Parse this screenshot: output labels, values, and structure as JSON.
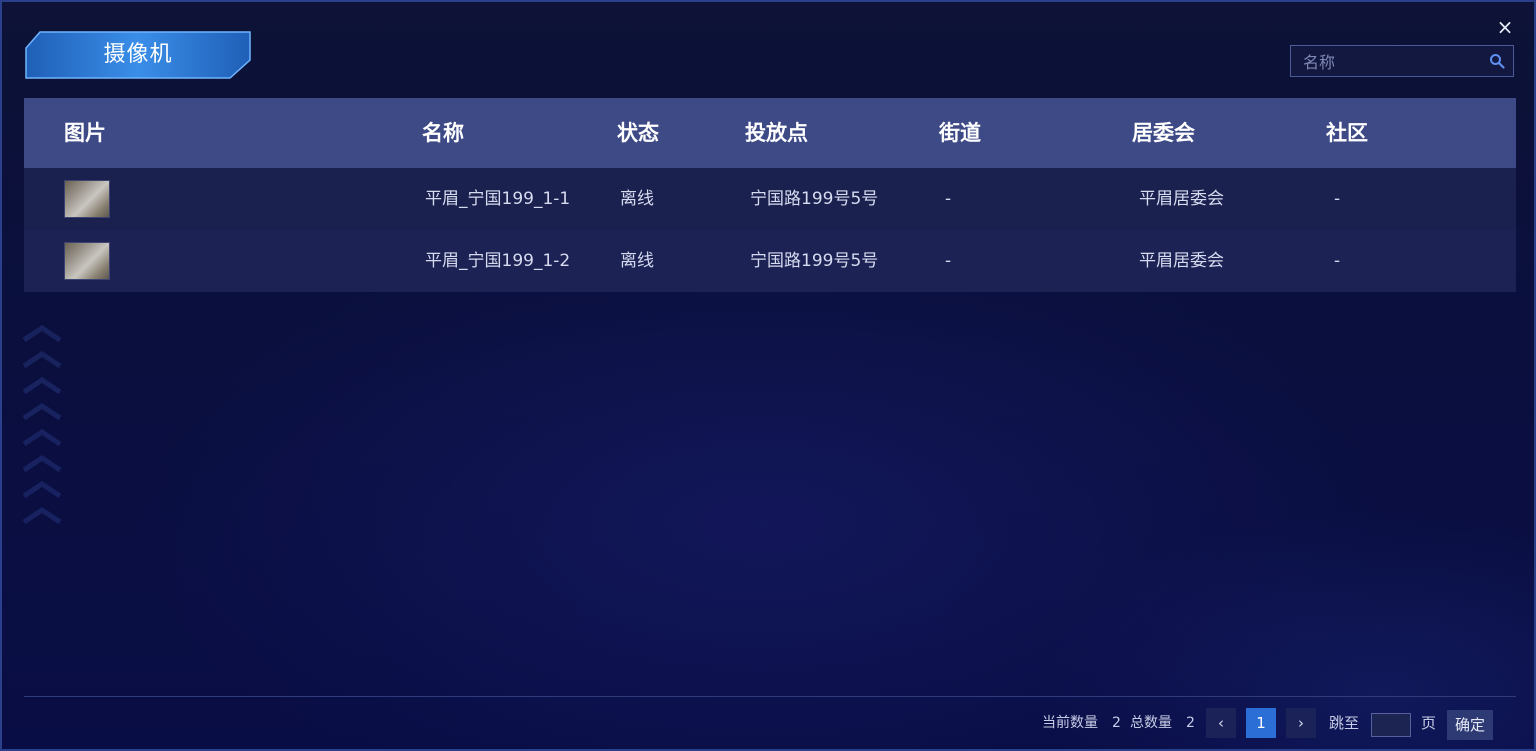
{
  "dialog": {
    "title": "摄像机",
    "close_label": "×"
  },
  "search": {
    "placeholder": "名称",
    "value": ""
  },
  "table": {
    "columns": [
      "图片",
      "名称",
      "状态",
      "投放点",
      "街道",
      "居委会",
      "社区"
    ],
    "rows": [
      {
        "name": "平眉_宁国199_1-1",
        "status": "离线",
        "location": "宁国路199号5号",
        "street": "-",
        "committee": "平眉居委会",
        "community": "-"
      },
      {
        "name": "平眉_宁国199_1-2",
        "status": "离线",
        "location": "宁国路199号5号",
        "street": "-",
        "committee": "平眉居委会",
        "community": "-"
      }
    ]
  },
  "pagination": {
    "current_count_label": "当前数量",
    "current_count": "2",
    "total_count_label": "总数量",
    "total_count": "2",
    "prev": "‹",
    "current_page": "1",
    "next": "›",
    "jump_label": "跳至",
    "jump_value": "",
    "page_unit": "页",
    "confirm_label": "确定"
  },
  "colors": {
    "background": "#0b0f3a",
    "header_bar": "#3d4a86",
    "accent": "#2b6fd6",
    "title_tab": "#2d7fd8"
  },
  "icons": {
    "close": "close-icon",
    "search": "search-icon",
    "prev": "chevron-left-icon",
    "next": "chevron-right-icon"
  }
}
